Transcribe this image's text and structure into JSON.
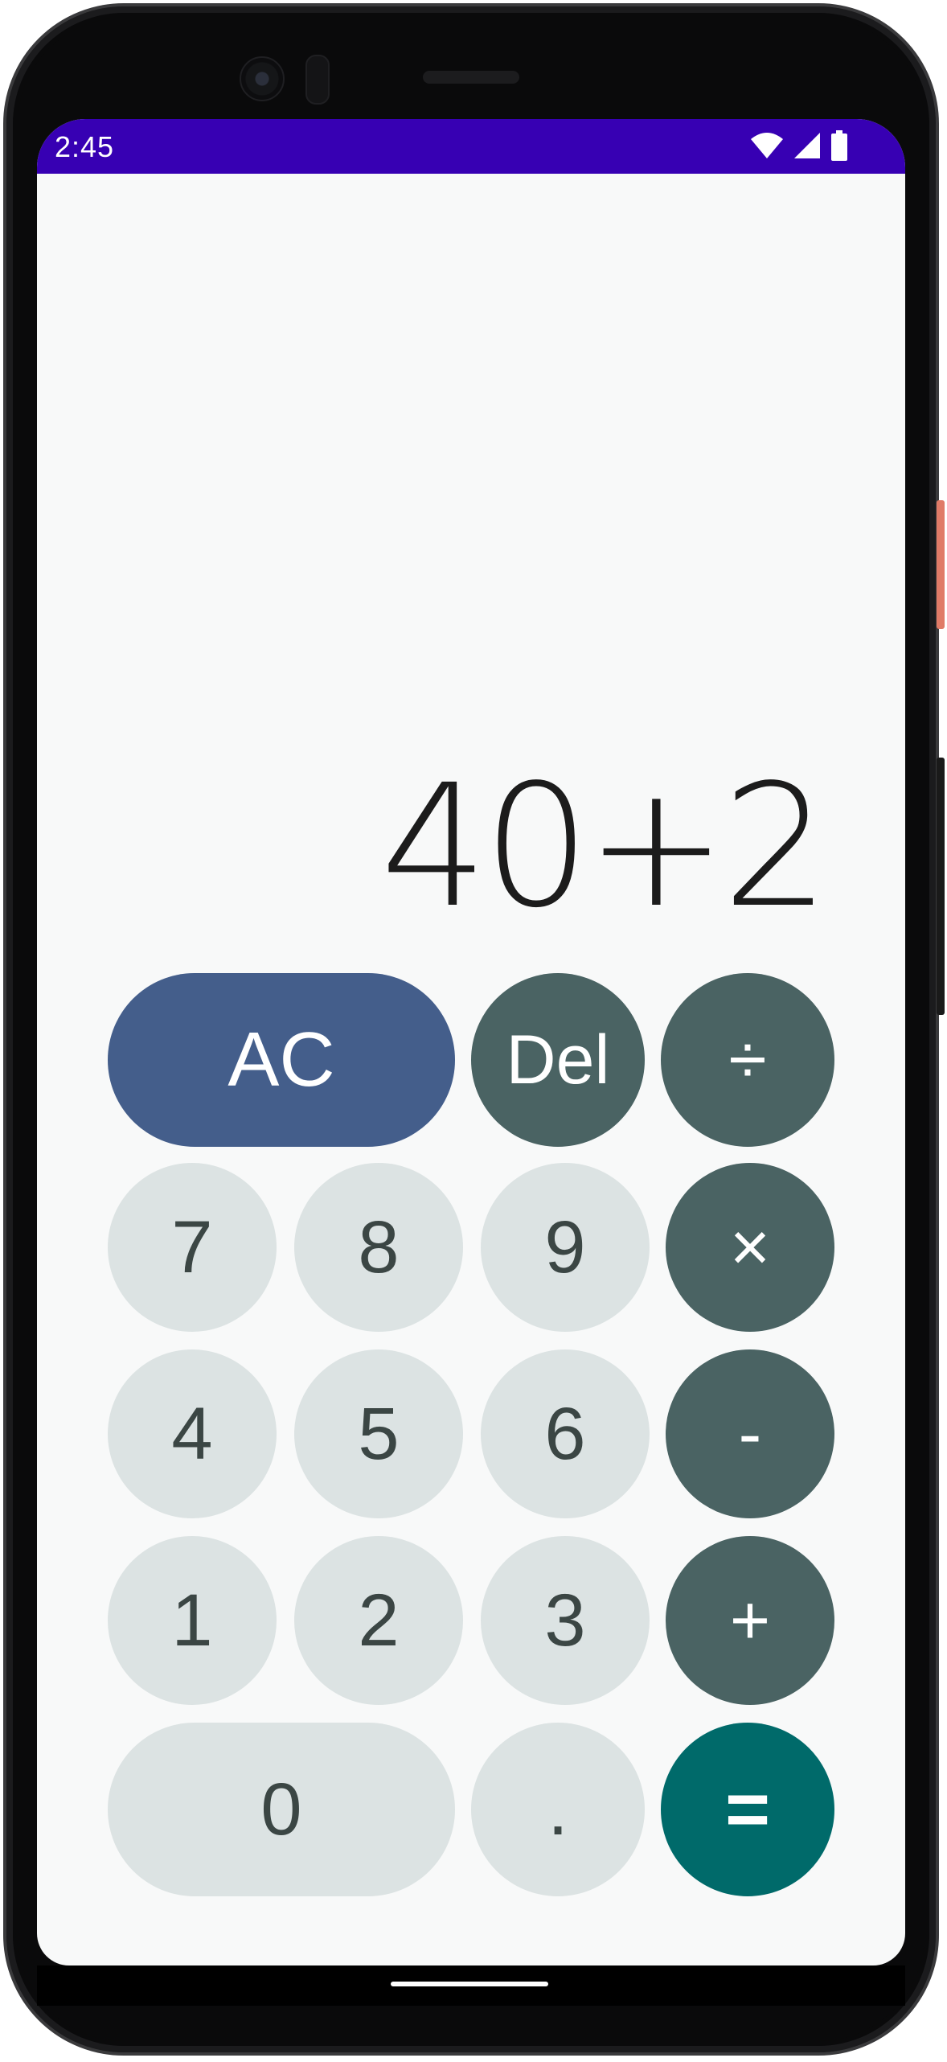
{
  "status_bar": {
    "time": "2:45",
    "icons": [
      "wifi-icon",
      "cellular-signal-icon",
      "battery-icon"
    ],
    "color": "#3700b3"
  },
  "display": {
    "expression": "40+2"
  },
  "keypad": {
    "ac": "AC",
    "del": "Del",
    "divide": "÷",
    "multiply": "×",
    "minus": "-",
    "plus": "+",
    "equals": "=",
    "decimal": ".",
    "digits": {
      "zero": "0",
      "one": "1",
      "two": "2",
      "three": "3",
      "four": "4",
      "five": "5",
      "six": "6",
      "seven": "7",
      "eight": "8",
      "nine": "9"
    }
  },
  "colors": {
    "number_key": "#dce3e3",
    "operator_key": "#4a6363",
    "clear_key": "#445e8b",
    "equals_key": "#006a6a"
  }
}
